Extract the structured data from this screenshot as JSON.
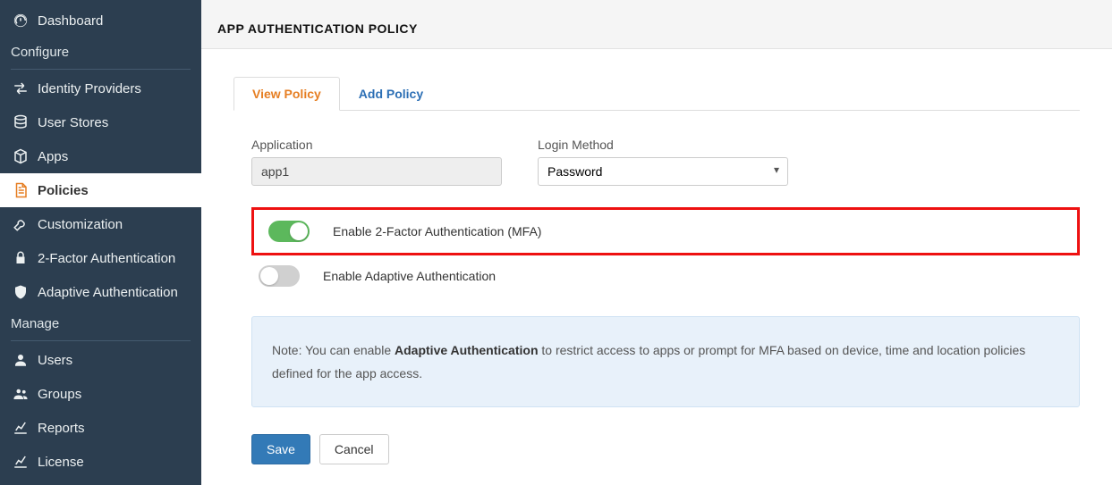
{
  "sidebar": {
    "dashboard": "Dashboard",
    "section_configure": "Configure",
    "identity_providers": "Identity Providers",
    "user_stores": "User Stores",
    "apps": "Apps",
    "policies": "Policies",
    "customization": "Customization",
    "two_factor": "2-Factor Authentication",
    "adaptive": "Adaptive Authentication",
    "section_manage": "Manage",
    "users": "Users",
    "groups": "Groups",
    "reports": "Reports",
    "license": "License"
  },
  "header": {
    "title": "APP AUTHENTICATION POLICY"
  },
  "tabs": {
    "view": "View Policy",
    "add": "Add Policy"
  },
  "form": {
    "application_label": "Application",
    "application_value": "app1",
    "login_method_label": "Login Method",
    "login_method_value": "Password",
    "mfa_label": "Enable 2-Factor Authentication (MFA)",
    "adaptive_label": "Enable Adaptive Authentication"
  },
  "note": {
    "prefix": "Note: You can enable ",
    "bold": "Adaptive Authentication",
    "suffix": " to restrict access to apps or prompt for MFA based on device, time and location policies defined for the app access."
  },
  "buttons": {
    "save": "Save",
    "cancel": "Cancel"
  }
}
